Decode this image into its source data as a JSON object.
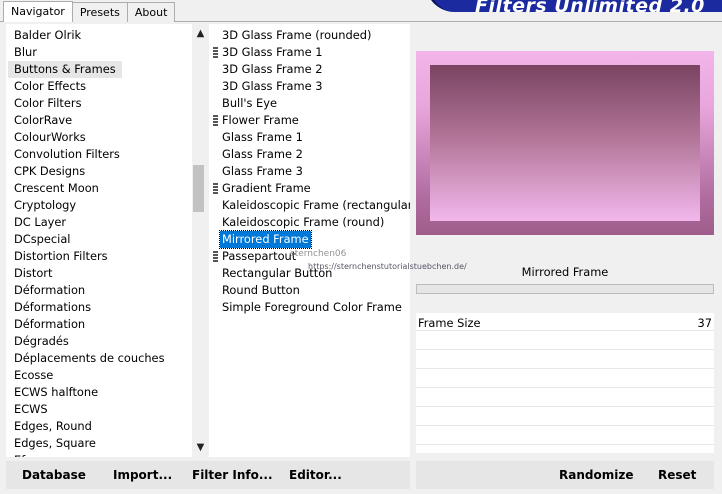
{
  "tabs": [
    "Navigator",
    "Presets",
    "About"
  ],
  "banner": "Filters Unlimited 2.0",
  "categories": [
    "Balder Olrik",
    "Blur",
    "Buttons & Frames",
    "Color Effects",
    "Color Filters",
    "ColorRave",
    "ColourWorks",
    "Convolution Filters",
    "CPK Designs",
    "Crescent Moon",
    "Cryptology",
    "DC Layer",
    "DCspecial",
    "Distortion Filters",
    "Distort",
    "Déformation",
    "Déformations",
    "Déformation",
    "Dégradés",
    "Déplacements de couches",
    "Ecosse",
    "ECWS halftone",
    "ECWS",
    "Edges, Round",
    "Edges, Square",
    "Ef..."
  ],
  "selected_category": "Buttons & Frames",
  "filters": [
    {
      "label": "3D Glass Frame (rounded)",
      "marked": false
    },
    {
      "label": "3D Glass Frame 1",
      "marked": true
    },
    {
      "label": "3D Glass Frame 2",
      "marked": false
    },
    {
      "label": "3D Glass Frame 3",
      "marked": false
    },
    {
      "label": "Bull's Eye",
      "marked": false
    },
    {
      "label": "Flower Frame",
      "marked": true
    },
    {
      "label": "Glass Frame 1",
      "marked": false
    },
    {
      "label": "Glass Frame 2",
      "marked": false
    },
    {
      "label": "Glass Frame 3",
      "marked": false
    },
    {
      "label": "Gradient Frame",
      "marked": true
    },
    {
      "label": "Kaleidoscopic Frame (rectangular)",
      "marked": false
    },
    {
      "label": "Kaleidoscopic Frame (round)",
      "marked": false
    },
    {
      "label": "Mirrored Frame",
      "marked": false
    },
    {
      "label": "Passepartout",
      "marked": true
    },
    {
      "label": "Rectangular Button",
      "marked": false
    },
    {
      "label": "Round Button",
      "marked": false
    },
    {
      "label": "Simple Foreground Color Frame",
      "marked": false
    }
  ],
  "selected_filter": "Mirrored Frame",
  "preview": {
    "filter_name": "Mirrored Frame",
    "outer_color": "#e8a6dc",
    "inner_color": "#b07395"
  },
  "params": [
    {
      "label": "Frame Size",
      "value": "37"
    }
  ],
  "watermark": {
    "name": "sternchen06",
    "url": "https://sternchenstutorialstuebchen.de/"
  },
  "buttons": {
    "database": "Database",
    "import": "Import...",
    "filter_info": "Filter Info...",
    "editor": "Editor...",
    "randomize": "Randomize",
    "reset": "Reset"
  }
}
